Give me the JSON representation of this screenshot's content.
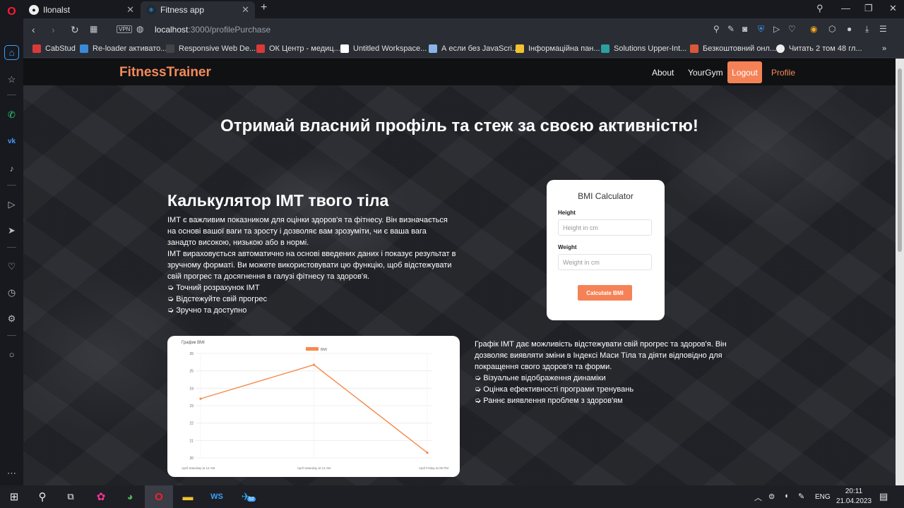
{
  "browser": {
    "tabs": [
      {
        "title": "Ilonalst"
      },
      {
        "title": "Fitness app"
      }
    ],
    "url_host": "localhost",
    "url_path": ":3000/profilePurchase",
    "vpn_label": "VPN",
    "bookmarks": [
      {
        "label": "CabStud",
        "color": "#d83a3a"
      },
      {
        "label": "Re-loader активато...",
        "color": "#3a8ad8"
      },
      {
        "label": "Responsive Web De...",
        "color": "#444444"
      },
      {
        "label": "ОК Центр - медиц...",
        "color": "#d83a3a"
      },
      {
        "label": "Untitled Workspace...",
        "color": "#ffffff"
      },
      {
        "label": "А если без JavaScri...",
        "color": "#8ab4e8"
      },
      {
        "label": "Інформаційна пан...",
        "color": "#f2c230"
      },
      {
        "label": "Solutions Upper-Int...",
        "color": "#2aa0a0"
      },
      {
        "label": "Безкоштовний онл...",
        "color": "#d8583a"
      },
      {
        "label": "Читать 2 том 48 гл...",
        "color": "#eeeeee"
      }
    ],
    "bookmarks_more": "»"
  },
  "site": {
    "brand": "FitnessTrainer",
    "nav": {
      "about": "About",
      "gym": "YourGym",
      "logout": "Logout",
      "profile": "Profile"
    },
    "hero": "Отримай власний профіль та стеж за своєю активністю!"
  },
  "calculator_intro": {
    "heading": "Калькулятор ІМТ твого тіла",
    "p1": "ІМТ є важливим показником для оцінки здоров'я та фітнесу. Він визначається на основі вашої ваги та зросту і дозволяє вам зрозуміти, чи є ваша вага занадто високою, низькою або в нормі.",
    "p2": "ІМТ вираховується автоматично на основі введених даних і показує результат в зручному форматі. Ви можете використовувати цю функцію, щоб відстежувати свій прогрес та досягнення в галузі фітнесу та здоров'я.",
    "bullets": [
      "➭ Точний розрахунок ІМТ",
      "➭ Відстежуйте свій прогрес",
      "➭ Зручно та доступно"
    ]
  },
  "bmi_card": {
    "title": "BMI Calculator",
    "height_label": "Height",
    "height_placeholder": "Height in cm",
    "weight_label": "Weight",
    "weight_placeholder": "Weight in cm",
    "button": "Calculate BMI"
  },
  "chart_data": {
    "type": "line",
    "title": "График BMI",
    "legend": "BMI",
    "legend_position": "top",
    "categories": [
      "April Saturday at 12 AM",
      "April Saturday at 12 AM",
      "April Friday at 08 PM"
    ],
    "series": [
      {
        "name": "BMI",
        "values": [
          23.4,
          25.35,
          20.3
        ],
        "color": "#f58a4a"
      }
    ],
    "yticks": [
      "26",
      "25",
      "24",
      "23",
      "22",
      "21",
      "20"
    ],
    "ylim": [
      20,
      26
    ],
    "grid": true
  },
  "chart_info": {
    "p": "Графік ІМТ дає можливість відстежувати свій прогрес та здоров'я. Він дозволяє виявляти зміни в Індексі Маси Тіла та діяти відповідно для покращення свого здоров'я та форми.",
    "bullets": [
      "➭ Візуальне відображення динаміки",
      "➭ Оцінка ефективності програми тренувань",
      "➭ Раннє виявлення проблем з здоров'ям"
    ]
  },
  "taskbar": {
    "lang": "ENG",
    "time": "20:11",
    "date": "21.04.2023",
    "telegram_badge": "52"
  }
}
